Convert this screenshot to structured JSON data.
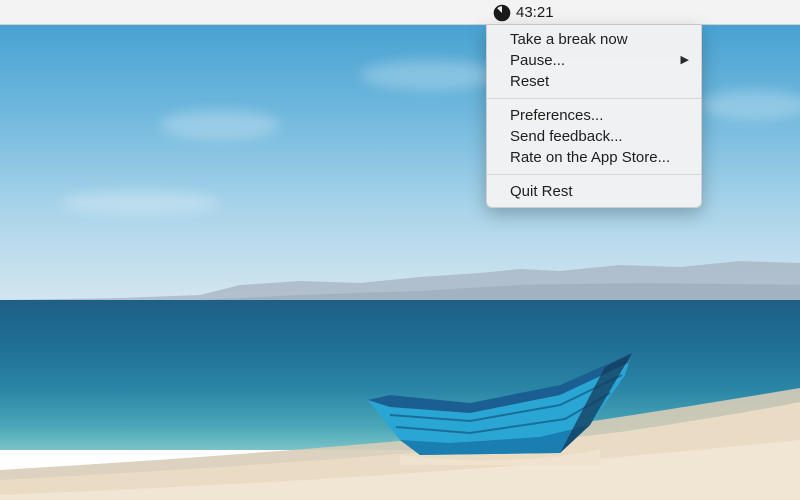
{
  "menubar": {
    "status_item": {
      "icon": "timer-pie-icon",
      "time": "43:21"
    }
  },
  "menu": {
    "groups": [
      [
        {
          "label": "Take a break now",
          "submenu": false
        },
        {
          "label": "Pause...",
          "submenu": true
        },
        {
          "label": "Reset",
          "submenu": false
        }
      ],
      [
        {
          "label": "Preferences...",
          "submenu": false
        },
        {
          "label": "Send feedback...",
          "submenu": false
        },
        {
          "label": "Rate on the App Store...",
          "submenu": false
        }
      ],
      [
        {
          "label": "Quit Rest",
          "submenu": false
        }
      ]
    ],
    "submenu_arrow": "▶"
  },
  "colors": {
    "menubar_bg": "#f3f3f3",
    "menu_bg": "#f2f2f2",
    "sky_top": "#3d9ccf",
    "sea": "#1f6f93",
    "boat": "#2aa6d4",
    "sand": "#eadcc4"
  }
}
